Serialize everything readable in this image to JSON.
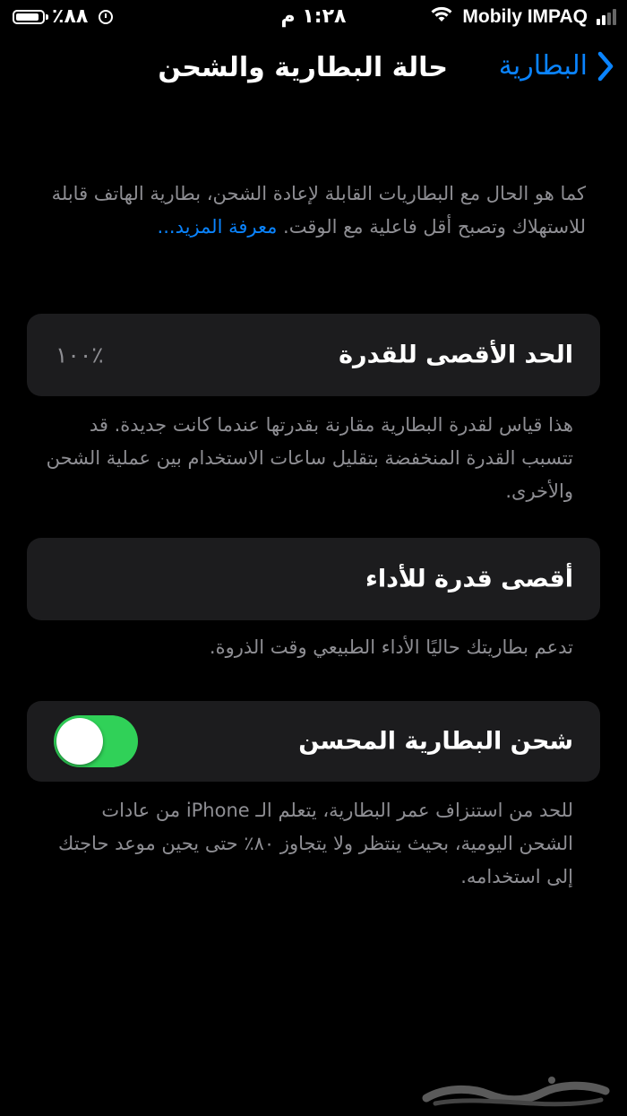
{
  "status_bar": {
    "battery_percent": "٪٨٨",
    "battery_level": 0.88,
    "time": "١:٢٨ م",
    "carrier": "Mobily IMPAQ"
  },
  "nav": {
    "back_label": "البطارية",
    "title": "حالة البطارية والشحن"
  },
  "intro": {
    "text": "كما هو الحال مع البطاريات القابلة لإعادة الشحن، بطارية الهاتف قابلة للاستهلاك وتصبح أقل فاعلية مع الوقت. ",
    "link": "معرفة المزيد..."
  },
  "max_capacity": {
    "label": "الحد الأقصى للقدرة",
    "value": "٪١٠٠",
    "footnote": "هذا قياس لقدرة البطارية مقارنة بقدرتها عندما كانت جديدة. قد تتسبب القدرة المنخفضة بتقليل ساعات الاستخدام بين عملية الشحن والأخرى."
  },
  "peak_performance": {
    "label": "أقصى قدرة للأداء",
    "footnote": "تدعم بطاريتك حاليًا الأداء الطبيعي وقت الذروة."
  },
  "optimized_charging": {
    "label": "شحن البطارية المحسن",
    "enabled": true,
    "footnote": "للحد من استنزاف عمر البطارية، يتعلم الـ iPhone من عادات الشحن اليومية، بحيث ينتظر ولا يتجاوز ٨٠٪ حتى يحين موعد حاجتك إلى استخدامه."
  },
  "colors": {
    "accent": "#0a84ff",
    "toggle_on": "#30d158",
    "card_bg": "#1c1c1e",
    "secondary_text": "#8e8e93"
  }
}
